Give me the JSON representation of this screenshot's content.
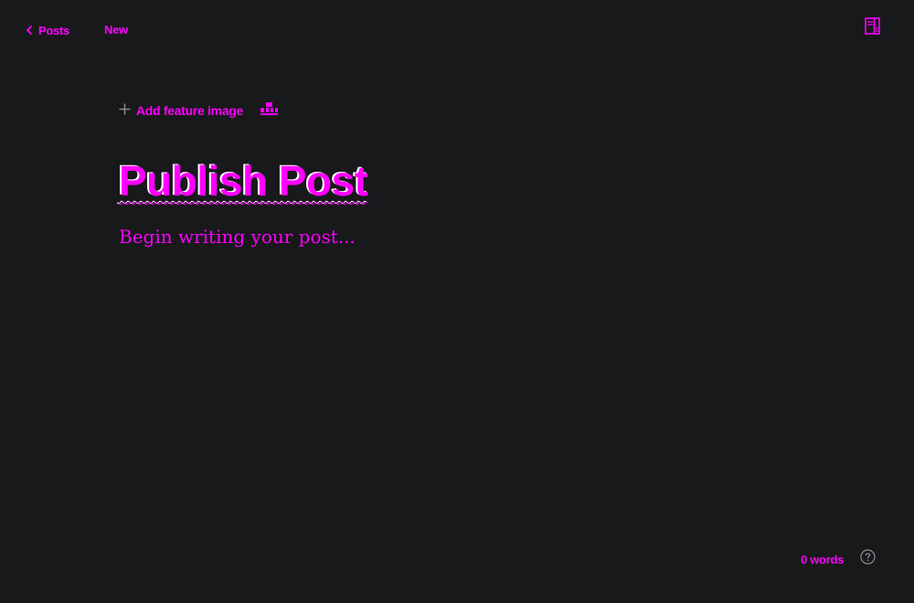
{
  "app": {
    "back_label": "Posts",
    "status_label": "New"
  },
  "icons": {
    "back": "chevron-left-icon",
    "sidebar": "sidebar-panel-icon",
    "add_feature": "plus-icon",
    "card": "snippet-card-icon",
    "help": "question-circle-icon"
  },
  "editor": {
    "add_feature_label": "Add feature image",
    "title": "Publish Post",
    "body_placeholder": "Begin writing your post..."
  },
  "footer": {
    "word_count": "0 words"
  },
  "colors": {
    "background": "#18191b",
    "text": "#ff00ff",
    "icon_muted": "#8e9094"
  }
}
